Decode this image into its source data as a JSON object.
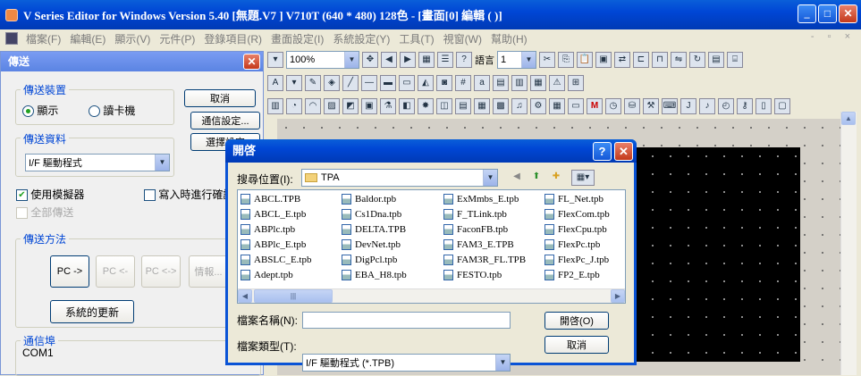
{
  "window": {
    "title": "V Series Editor for Windows Version 5.40 [無題.V7 ] V710T (640 * 480) 128色 - [畫面[0] 編輯 (            )]"
  },
  "menu": {
    "items": [
      "檔案(F)",
      "編輯(E)",
      "顯示(V)",
      "元件(P)",
      "登錄項目(R)",
      "畫面設定(I)",
      "系統設定(Y)",
      "工具(T)",
      "視窗(W)",
      "幫助(H)"
    ]
  },
  "toolbar": {
    "zoom": "100%",
    "language_label": "語言",
    "language_value": "1"
  },
  "transfer": {
    "title": "傳送",
    "device_group": "傳送裝置",
    "radio_display": "顯示",
    "radio_card": "讀卡機",
    "cancel": "取消",
    "comm_settings": "通信設定...",
    "select_settings": "選擇設定",
    "data_group": "傳送資料",
    "data_value": "I/F 驅動程式",
    "use_simulator": "使用模擬器",
    "verify_on_write": "寫入時進行確認",
    "transfer_all": "全部傳送",
    "method_group": "傳送方法",
    "pc_to": "PC ->",
    "pc_from": "PC <-",
    "pc_both": "PC <->",
    "info": "情報...",
    "system_update": "系統的更新",
    "port_group": "通信埠",
    "port_value": "COM1"
  },
  "dialog": {
    "title": "開啓",
    "look_in_label": "搜尋位置(I):",
    "look_in_value": "TPA",
    "files": [
      [
        "ABCL.TPB",
        "ABCL_E.tpb",
        "ABPlc.tpb",
        "ABPlc_E.tpb",
        "ABSLC_E.tpb",
        "Adept.tpb"
      ],
      [
        "Baldor.tpb",
        "Cs1Dna.tpb",
        "DELTA.TPB",
        "DevNet.tpb",
        "DigPcl.tpb",
        "EBA_H8.tpb"
      ],
      [
        "ExMmbs_E.tpb",
        "F_TLink.tpb",
        "FaconFB.tpb",
        "FAM3_E.TPB",
        "FAM3R_FL.TPB",
        "FESTO.tpb"
      ],
      [
        "FL_Net.tpb",
        "FlexCom.tpb",
        "FlexCpu.tpb",
        "FlexPc.tpb",
        "FlexPc_J.tpb",
        "FP2_E.tpb"
      ]
    ],
    "filename_label": "檔案名稱(N):",
    "filename_value": "",
    "filetype_label": "檔案類型(T):",
    "filetype_value": "I/F 驅動程式 (*.TPB)",
    "open_button": "開啓(O)",
    "cancel_button": "取消"
  }
}
